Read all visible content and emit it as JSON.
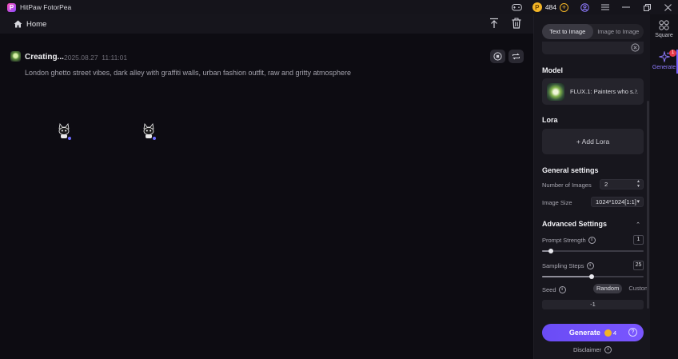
{
  "window": {
    "title": "HitPaw FotorPea",
    "credits": "484"
  },
  "topbar": {
    "home_label": "Home"
  },
  "job": {
    "status": "Creating...",
    "date": "2025.08.27",
    "time": "11:11:01",
    "prompt": "London ghetto street vibes, dark alley with graffiti walls, urban fashion outfit, raw and gritty atmosphere"
  },
  "panel": {
    "tabs": [
      "Text to Image",
      "Image to Image"
    ],
    "active_tab": "Text to Image",
    "model_title": "Model",
    "model_name": "FLUX.1: Painters who s...",
    "lora_title": "Lora",
    "add_lora_label": "+ Add Lora",
    "general_title": "General settings",
    "num_images_label": "Number of Images",
    "num_images_value": "2",
    "image_size_label": "Image Size",
    "image_size_value": "1024*1024[1:1]",
    "advanced_title": "Advanced Settings",
    "prompt_strength_label": "Prompt Strength",
    "prompt_strength_value": "1",
    "prompt_strength_fraction": 0.09,
    "sampling_steps_label": "Sampling Steps",
    "sampling_steps_value": "25",
    "sampling_steps_fraction": 0.49,
    "seed_label": "Seed",
    "seed_options": [
      "Random",
      "Custom"
    ],
    "seed_value": "-1",
    "generate_label": "Generate",
    "generate_cost": "4",
    "disclaimer_label": "Disclaimer"
  },
  "rail": {
    "square_label": "Square",
    "generate_label": "Generate",
    "generate_badge": "1"
  },
  "colors": {
    "accent": "#7a56ff",
    "coin": "#f3b526",
    "badge": "#e83b4a"
  }
}
